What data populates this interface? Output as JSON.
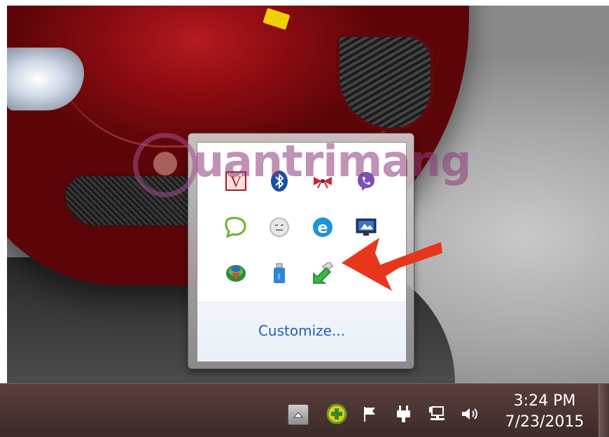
{
  "watermark": {
    "text": "uantrimang"
  },
  "tray_overflow": {
    "icons": [
      {
        "name": "vietkey-icon",
        "label": "V"
      },
      {
        "name": "bluetooth-icon"
      },
      {
        "name": "ribbon-icon"
      },
      {
        "name": "viber-icon"
      },
      {
        "name": "chat-bubble-icon"
      },
      {
        "name": "emoji-icon"
      },
      {
        "name": "internet-explorer-icon",
        "label": "e"
      },
      {
        "name": "monitor-icon"
      },
      {
        "name": "download-manager-icon"
      },
      {
        "name": "usb-drive-icon"
      },
      {
        "name": "safely-remove-hardware-icon"
      }
    ],
    "customize_label": "Customize..."
  },
  "taskbar": {
    "icons": [
      {
        "name": "show-hidden-icons-button"
      },
      {
        "name": "green-plus-icon"
      },
      {
        "name": "action-center-flag-icon"
      },
      {
        "name": "power-plug-icon"
      },
      {
        "name": "network-icon"
      },
      {
        "name": "volume-icon"
      }
    ],
    "clock": {
      "time": "3:24 PM",
      "date": "7/23/2015"
    }
  },
  "colors": {
    "link": "#1f5fb8",
    "arrow": "#e8361d",
    "taskbar": "#4a3431"
  }
}
